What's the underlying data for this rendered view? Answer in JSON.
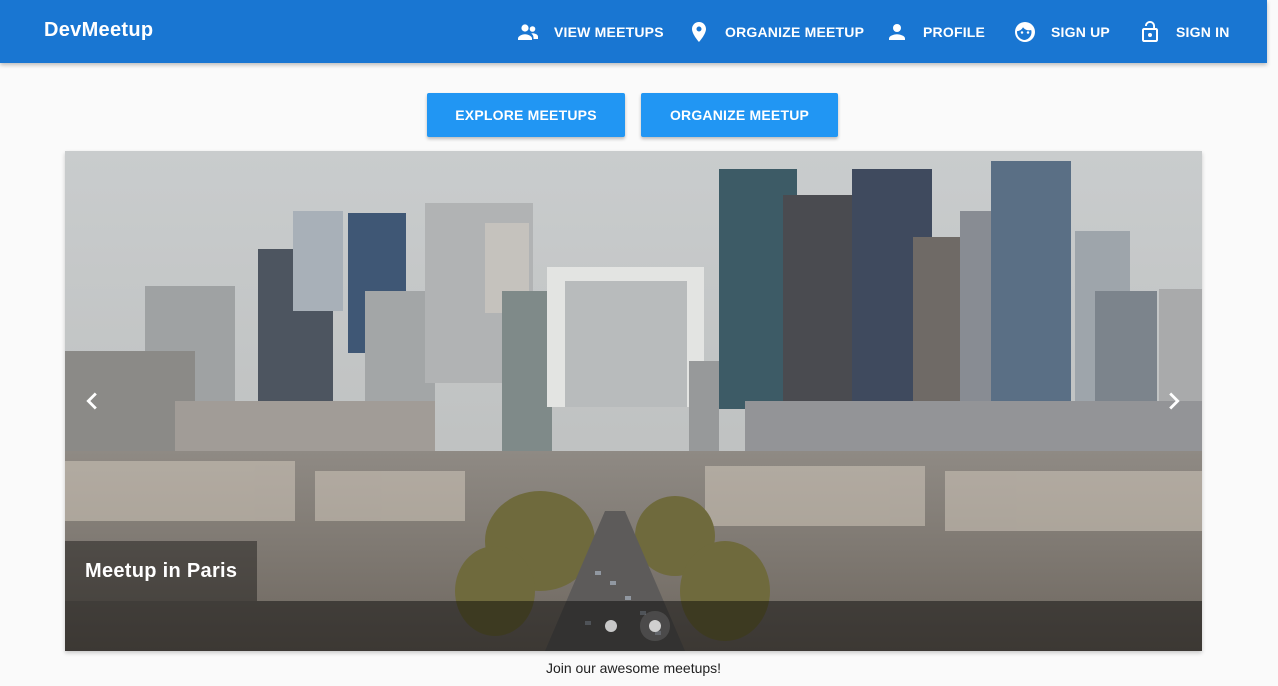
{
  "app": {
    "title": "DevMeetup"
  },
  "nav": {
    "items": [
      {
        "label": "VIEW MEETUPS",
        "icon": "supervisor-account-icon"
      },
      {
        "label": "ORGANIZE MEETUP",
        "icon": "room-icon"
      },
      {
        "label": "PROFILE",
        "icon": "person-icon"
      },
      {
        "label": "SIGN UP",
        "icon": "face-icon"
      },
      {
        "label": "SIGN IN",
        "icon": "lock-open-icon"
      }
    ]
  },
  "actions": {
    "explore_label": "EXPLORE MEETUPS",
    "organize_label": "ORGANIZE MEETUP"
  },
  "carousel": {
    "caption": "Meetup in Paris",
    "slides_count": 2,
    "active_slide": 2,
    "prev_icon": "chevron-left-icon",
    "next_icon": "chevron-right-icon"
  },
  "footer": {
    "tagline": "Join our awesome meetups!"
  },
  "colors": {
    "toolbar": "#1976d2",
    "button": "#2196f3",
    "background": "#fafafa"
  }
}
